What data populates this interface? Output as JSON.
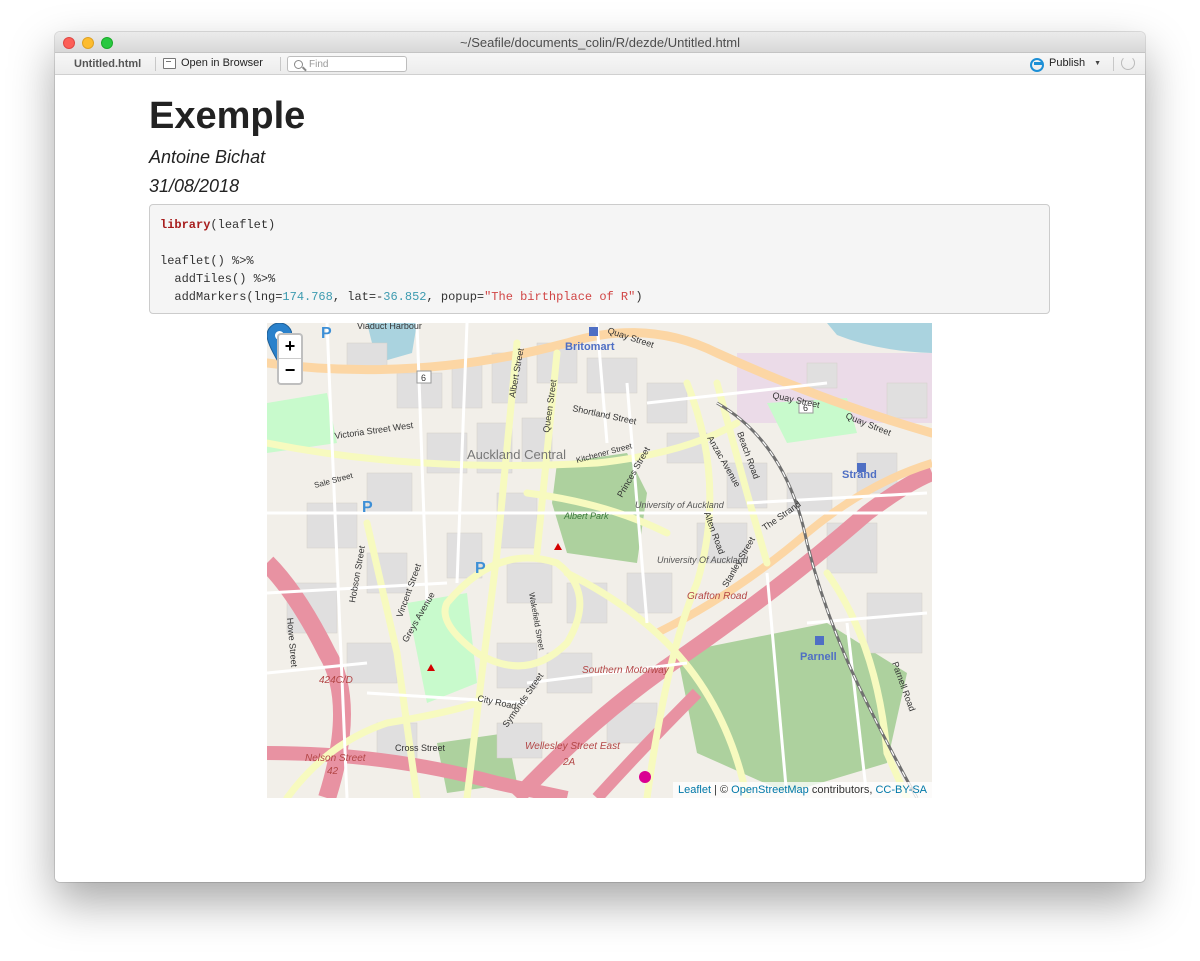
{
  "window": {
    "title": "~/Seafile/documents_colin/R/dezde/Untitled.html"
  },
  "toolbar": {
    "tab_label": "Untitled.html",
    "open_browser_label": "Open in Browser",
    "find_placeholder": "Find",
    "publish_label": "Publish"
  },
  "document": {
    "title": "Exemple",
    "author": "Antoine Bichat",
    "date": "31/08/2018"
  },
  "code": {
    "kw_library": "library",
    "line1_rest": "(leaflet)",
    "line2": "leaflet() %>%",
    "line3": "  addTiles() %>%",
    "line4_pre": "  addMarkers(lng=",
    "lng": "174.768",
    "line4_mid": ", lat=-",
    "lat": "36.852",
    "line4_mid2": ", popup=",
    "popup": "\"The birthplace of R\"",
    "line4_end": ")"
  },
  "map": {
    "zoom_in": "+",
    "zoom_out": "−",
    "attribution": {
      "leaflet": "Leaflet",
      "sep": " | © ",
      "osm": "OpenStreetMap",
      "contrib": " contributors, ",
      "license": "CC-BY-SA"
    },
    "labels": {
      "viaduct": "Viaduct Harbour",
      "britomart": "Britomart",
      "quay1": "Quay Street",
      "quay2": "Quay Street",
      "quay3": "Quay Street",
      "victoria": "Victoria Street West",
      "auckland": "Auckland Central",
      "shortland": "Shortland Street",
      "albert_st": "Albert Street",
      "queen_st": "Queen Street",
      "albert_park": "Albert Park",
      "uoa1": "University of Auckland",
      "uoa2": "University Of Auckland",
      "grafton": "Grafton Road",
      "southern": "Southern Motorway",
      "strand": "Strand",
      "the_strand": "The Strand",
      "parnell": "Parnell",
      "parnell_rd": "Parnell Road",
      "stanley": "Stanley Street",
      "symonds": "Symonds Street",
      "wellesley": "Wellesley Street East",
      "nelson": "Nelson Street",
      "hobson": "Hobson Street",
      "howe": "Howe Street",
      "greys": "Greys Avenue",
      "vincent": "Vincent Street",
      "city_road": "City Road",
      "cross": "Cross Street",
      "beach": "Beach Road",
      "anzac": "Anzac Avenue",
      "alten": "Alten Road",
      "princes": "Princes Street",
      "kitchener": "Kitchener Street",
      "sale": "Sale Street",
      "wakefield": "Wakefield Street",
      "route6a": "6",
      "route6b": "6",
      "route424": "424C/D",
      "route2a": "2A",
      "route42": "42"
    },
    "colors": {
      "background": "#f2efe9",
      "primary_road": "#f7fabf",
      "motorway": "#e892a2",
      "trunk": "#fcd6a4",
      "park": "#add19e",
      "water": "#aad3df",
      "marker": "#2a81cb"
    }
  }
}
